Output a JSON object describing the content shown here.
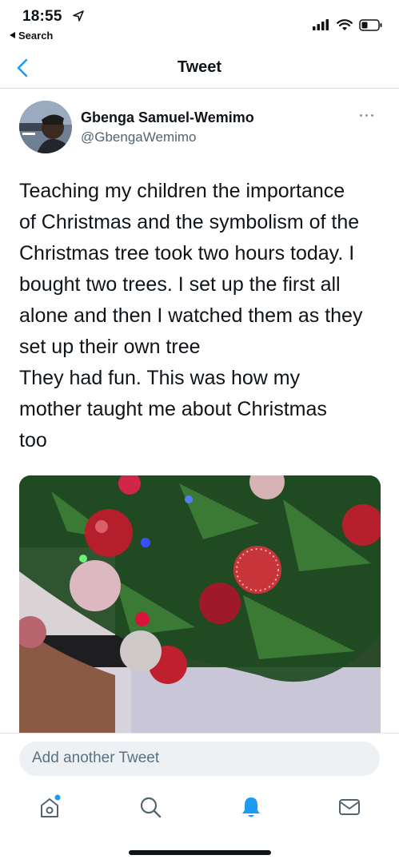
{
  "status_bar": {
    "time": "18:55",
    "back_app": "Search"
  },
  "nav": {
    "title": "Tweet"
  },
  "tweet": {
    "author_name": "Gbenga Samuel-Wemimo",
    "author_handle": "@GbengaWemimo",
    "text": "Teaching my children the importance\nof Christmas and the symbolism of the\nChristmas tree took two hours today. I\nbought two trees. I set up the first all\nalone and then I watched them as they\nset up their own tree\nThey had fun. This was how my\nmother taught me about Christmas\ntoo"
  },
  "composer": {
    "placeholder": "Add another Tweet"
  },
  "tabs": [
    {
      "icon": "home-icon",
      "badge": true
    },
    {
      "icon": "search-icon"
    },
    {
      "icon": "notifications-bell-icon",
      "active": true
    },
    {
      "icon": "messages-envelope-icon"
    }
  ],
  "colors": {
    "accent": "#1d9bf0",
    "text": "#0f1419",
    "secondary_text": "#536471",
    "composer_bg": "#eef1f4"
  }
}
